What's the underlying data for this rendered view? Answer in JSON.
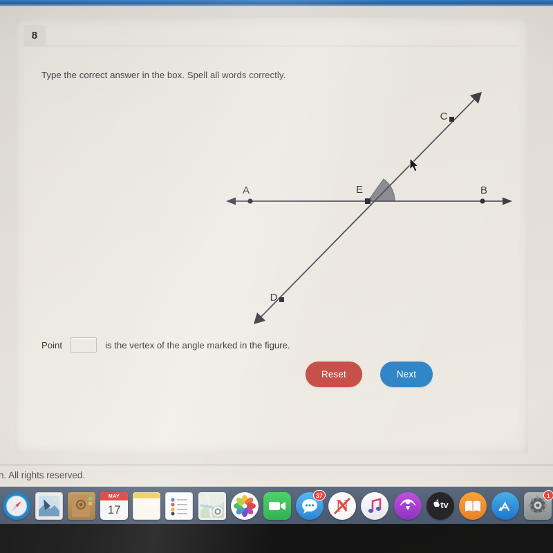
{
  "question": {
    "number": "8",
    "instruction": "Type the correct answer in the box. Spell all words correctly."
  },
  "figure": {
    "type": "two-intersecting-lines-with-marked-angle",
    "points": [
      {
        "label": "A",
        "marker": "circle"
      },
      {
        "label": "B",
        "marker": "circle"
      },
      {
        "label": "C",
        "marker": "square"
      },
      {
        "label": "D",
        "marker": "square"
      },
      {
        "label": "E",
        "marker": "square"
      }
    ],
    "marked_angle": "angle between ray EC and ray EB at vertex E",
    "stroke_color": "#53535c",
    "angle_fill_color": "#8c8c93"
  },
  "answer": {
    "lead_text": "Point",
    "input_value": "",
    "input_placeholder": "",
    "trail_text": "is the vertex of the angle marked in the figure."
  },
  "buttons": {
    "reset_label": "Reset",
    "reset_color": "#c8504a",
    "next_label": "Next",
    "next_color": "#3186c8"
  },
  "footer": {
    "text": "n. All rights reserved."
  },
  "dock": {
    "items": [
      {
        "name": "safari-icon",
        "label": "Safari"
      },
      {
        "name": "mail-icon",
        "label": "Mail"
      },
      {
        "name": "contacts-icon",
        "label": "Contacts"
      },
      {
        "name": "calendar-icon",
        "label": "Calendar",
        "month": "MAY",
        "day": "17"
      },
      {
        "name": "notes-icon",
        "label": "Notes"
      },
      {
        "name": "reminders-icon",
        "label": "Reminders"
      },
      {
        "name": "maps-icon",
        "label": "Maps"
      },
      {
        "name": "photos-icon",
        "label": "Photos"
      },
      {
        "name": "facetime-icon",
        "label": "FaceTime"
      },
      {
        "name": "messages-icon",
        "label": "Messages",
        "badge": "37"
      },
      {
        "name": "news-icon",
        "label": "News"
      },
      {
        "name": "music-icon",
        "label": "Music"
      },
      {
        "name": "podcasts-icon",
        "label": "Podcasts"
      },
      {
        "name": "appletv-icon",
        "label": "tv"
      },
      {
        "name": "books-icon",
        "label": "Books"
      },
      {
        "name": "app-store-icon",
        "label": "App Store"
      },
      {
        "name": "system-preferences-icon",
        "label": "System Preferences",
        "badge": "1"
      }
    ]
  }
}
